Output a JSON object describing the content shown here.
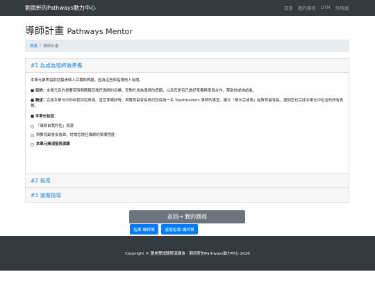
{
  "navbar": {
    "brand": "劉雨軒的Pathways動力中心",
    "links": [
      "首頁",
      "我的路徑",
      "DTM",
      "計時器"
    ]
  },
  "page": {
    "title": "導師計畫",
    "subtitle": "Pathways Mentor"
  },
  "breadcrumb": {
    "home": "首頁",
    "separator": "/",
    "current": "導師計畫"
  },
  "accordion": {
    "section1": {
      "title": "#1 為成為導師做準備",
      "intro": "本單元聚焦協助您釐清個人目標與興趣，因為這些與指導他人有關。",
      "goal_label": "目的：",
      "goal_text": "本單元目的是要花時間瞭解您擔任導師的目標，您對於成為導師的意願，以及您是否已做好準備與學員合作，幫助他或她前進。",
      "overview_label": "概述：",
      "overview_text": "完成本單元中的自我評估資源。當您準備好時，與教育副會長商討您成為一名 Toastmasters 導師的事宜。繳交「單元完成表」給教育副會長，證明您已完成本單元中包含的所有表格。",
      "includes_label": "本單元包括：",
      "items": [
        "「導師自我評估」資源",
        "與教育副會長會面，討論您擔任導師的準備程度",
        "本單元無須發表演講"
      ]
    },
    "section2_title": "#2 指導",
    "section3_title": "#3 進階指導"
  },
  "buttons": {
    "back": "返回→ 我的路徑",
    "mentor_eval": "指導-講評單",
    "advanced_eval": "進階指導-講評單"
  },
  "footer": {
    "text": "Copyright © 國美雙語國際演講會 - 劉雨軒的Pathways動力中心 2020"
  }
}
